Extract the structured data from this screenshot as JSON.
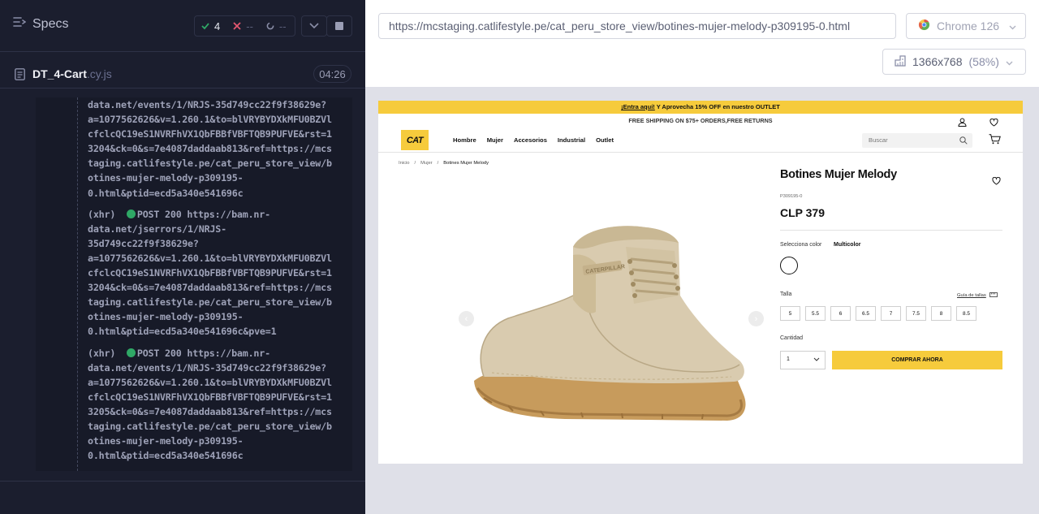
{
  "runner": {
    "specs_title": "Specs",
    "stats": {
      "passed": "4",
      "failed": "--",
      "pending": "--"
    },
    "file": {
      "name": "DT_4-Cart",
      "ext": ".cy.js",
      "time": "04:26"
    },
    "log_lines": [
      "data.net/events/1/NRJS-35d749cc22f9f38629e?",
      "a=1077562626&v=1.260.1&to=blVRYBYDXkMFU0BZVl",
      "cfclcQC19eS1NVRFhVX1QbFBBfVBFTQB9PUFVE&rst=1",
      "3204&ck=0&s=7e4087daddaab813&ref=https://mcs",
      "taging.catlifestyle.pe/cat_peru_store_view/b",
      "otines-mujer-melody-p309195-",
      "0.html&ptid=ecd5a340e541696c",
      "",
      "(xhr)  ●POST 200 https://bam.nr-",
      "data.net/jserrors/1/NRJS-",
      "35d749cc22f9f38629e?",
      "a=1077562626&v=1.260.1&to=blVRYBYDXkMFU0BZVl",
      "cfclcQC19eS1NVRFhVX1QbFBBfVBFTQB9PUFVE&rst=1",
      "3204&ck=0&s=7e4087daddaab813&ref=https://mcs",
      "taging.catlifestyle.pe/cat_peru_store_view/b",
      "otines-mujer-melody-p309195-",
      "0.html&ptid=ecd5a340e541696c&pve=1",
      "",
      "(xhr)  ●POST 200 https://bam.nr-",
      "data.net/events/1/NRJS-35d749cc22f9f38629e?",
      "a=1077562626&v=1.260.1&to=blVRYBYDXkMFU0BZVl",
      "cfclcQC19eS1NVRFhVX1QbFBBfVBFTQB9PUFVE&rst=1",
      "3205&ck=0&s=7e4087daddaab813&ref=https://mcs",
      "taging.catlifestyle.pe/cat_peru_store_view/b",
      "otines-mujer-melody-p309195-",
      "0.html&ptid=ecd5a340e541696c"
    ]
  },
  "browser": {
    "url": "https://mcstaging.catlifestyle.pe/cat_peru_store_view/botines-mujer-melody-p309195-0.html",
    "name": "Chrome 126",
    "viewport": "1366x768",
    "zoom": "(58%)"
  },
  "app": {
    "promo_link": "¡Entra aquí!",
    "promo_rest": " Y Aprovecha 15% OFF en nuestro OUTLET",
    "shipping": "FREE SHIPPING ON $75+ ORDERS,FREE RETURNS",
    "logo": "CAT",
    "menu": [
      "Hombre",
      "Mujer",
      "Accesorios",
      "Industrial",
      "Outlet"
    ],
    "search_placeholder": "Buscar",
    "breadcrumbs": [
      "Inicio",
      "Mujer",
      "Botines Mujer Melody"
    ],
    "product_title": "Botines Mujer Melody",
    "sku": "P309195-0",
    "price": "CLP 379",
    "color_label": "Selecciona color",
    "color_value": "Multicolor",
    "size_label": "Talla",
    "size_guide": "Guía de tallas",
    "sizes": [
      "5",
      "5.5",
      "6",
      "6.5",
      "7",
      "7.5",
      "8",
      "8.5"
    ],
    "qty_label": "Cantidad",
    "qty_value": "1",
    "buy_label": "COMPRAR AHORA",
    "boot_brand_text": "CATERPILLAR"
  },
  "colors": {
    "runner_bg": "#1b1e2e",
    "accent_yellow": "#f6cb3c",
    "pass_green": "#2fa866",
    "fail_red": "#e45770"
  }
}
